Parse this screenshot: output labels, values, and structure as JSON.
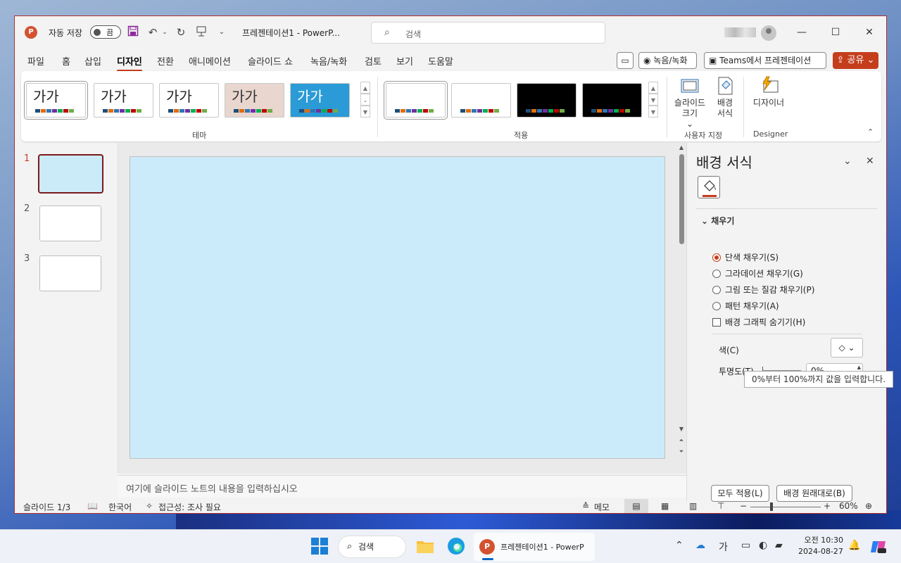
{
  "titlebar": {
    "logo": "P",
    "autosave_label": "자동 저장",
    "autosave_state": "끔",
    "doc_title": "프레젠테이션1  -  PowerP...",
    "search_placeholder": "검색"
  },
  "menu": {
    "items": [
      "파일",
      "홈",
      "삽입",
      "디자인",
      "전환",
      "애니메이션",
      "슬라이드 쇼",
      "녹음/녹화",
      "검토",
      "보기",
      "도움말"
    ],
    "active": "디자인",
    "record_label": "녹음/녹화",
    "teams_label": "Teams에서 프레젠테이션",
    "share_label": "공유"
  },
  "ribbon": {
    "themes": [
      {
        "text": "가가",
        "bg": "#ffffff",
        "fg": "#222222"
      },
      {
        "text": "가가",
        "bg": "#ffffff",
        "fg": "#222222"
      },
      {
        "text": "가가",
        "bg": "#ffffff",
        "fg": "#222222"
      },
      {
        "text": "가가",
        "bg": "#e8d6cf",
        "fg": "#333333"
      },
      {
        "text": "가가",
        "bg": "#2a9bd6",
        "fg": "#ffffff"
      }
    ],
    "variants": [
      {
        "bg": "#ffffff"
      },
      {
        "bg": "#ffffff"
      },
      {
        "bg": "#000000"
      },
      {
        "bg": "#000000"
      }
    ],
    "theme_group_label": "테마",
    "variant_group_label": "적용",
    "slide_size_label": "슬라이드 크기",
    "bg_format_label": "배경 서식",
    "customize_group_label": "사용자 지정",
    "designer_label": "디자이너",
    "designer_group_label": "Designer"
  },
  "slides": {
    "numbers": [
      "1",
      "2",
      "3"
    ],
    "notes_placeholder": "여기에 슬라이드 노트의 내용을 입력하십시오",
    "canvas_color": "#ccebfa"
  },
  "format_pane": {
    "title": "배경 서식",
    "section": "채우기",
    "options": [
      "단색 채우기(S)",
      "그라데이션 채우기(G)",
      "그림 또는 질감 채우기(P)",
      "패턴 채우기(A)"
    ],
    "selected_option": 0,
    "hide_graphics": "배경 그래픽 숨기기(H)",
    "color_label": "색(C)",
    "transparency_label": "투명도(T)",
    "transparency_value": "0%",
    "tooltip": "0%부터 100%까지 값을 입력합니다.",
    "apply_all": "모두 적용(L)",
    "reset_bg": "배경 원래대로(B)"
  },
  "statusbar": {
    "slide_info": "슬라이드 1/3",
    "language": "한국어",
    "accessibility": "접근성: 조사 필요",
    "notes_label": "메모",
    "zoom": "60%"
  },
  "taskbar": {
    "search": "검색",
    "app_label": "프레젠테이션1 - PowerP",
    "ime": "가",
    "time": "오전 10:30",
    "date": "2024-08-27"
  },
  "colors": {
    "accent": "#c43e1c",
    "slide_selected_border": "#7a1a1a"
  }
}
